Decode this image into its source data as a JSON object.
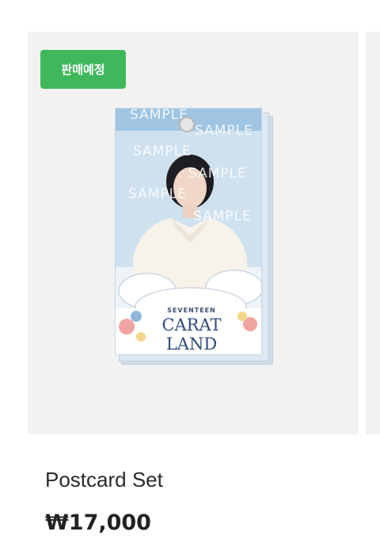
{
  "product": {
    "badge_label": "판매예정",
    "image": {
      "watermark_text": "SAMPLE",
      "logo_top": "SEVENTEEN",
      "logo_main": "CARAT LAND"
    },
    "title": "Postcard Set",
    "price": "₩17,000"
  }
}
